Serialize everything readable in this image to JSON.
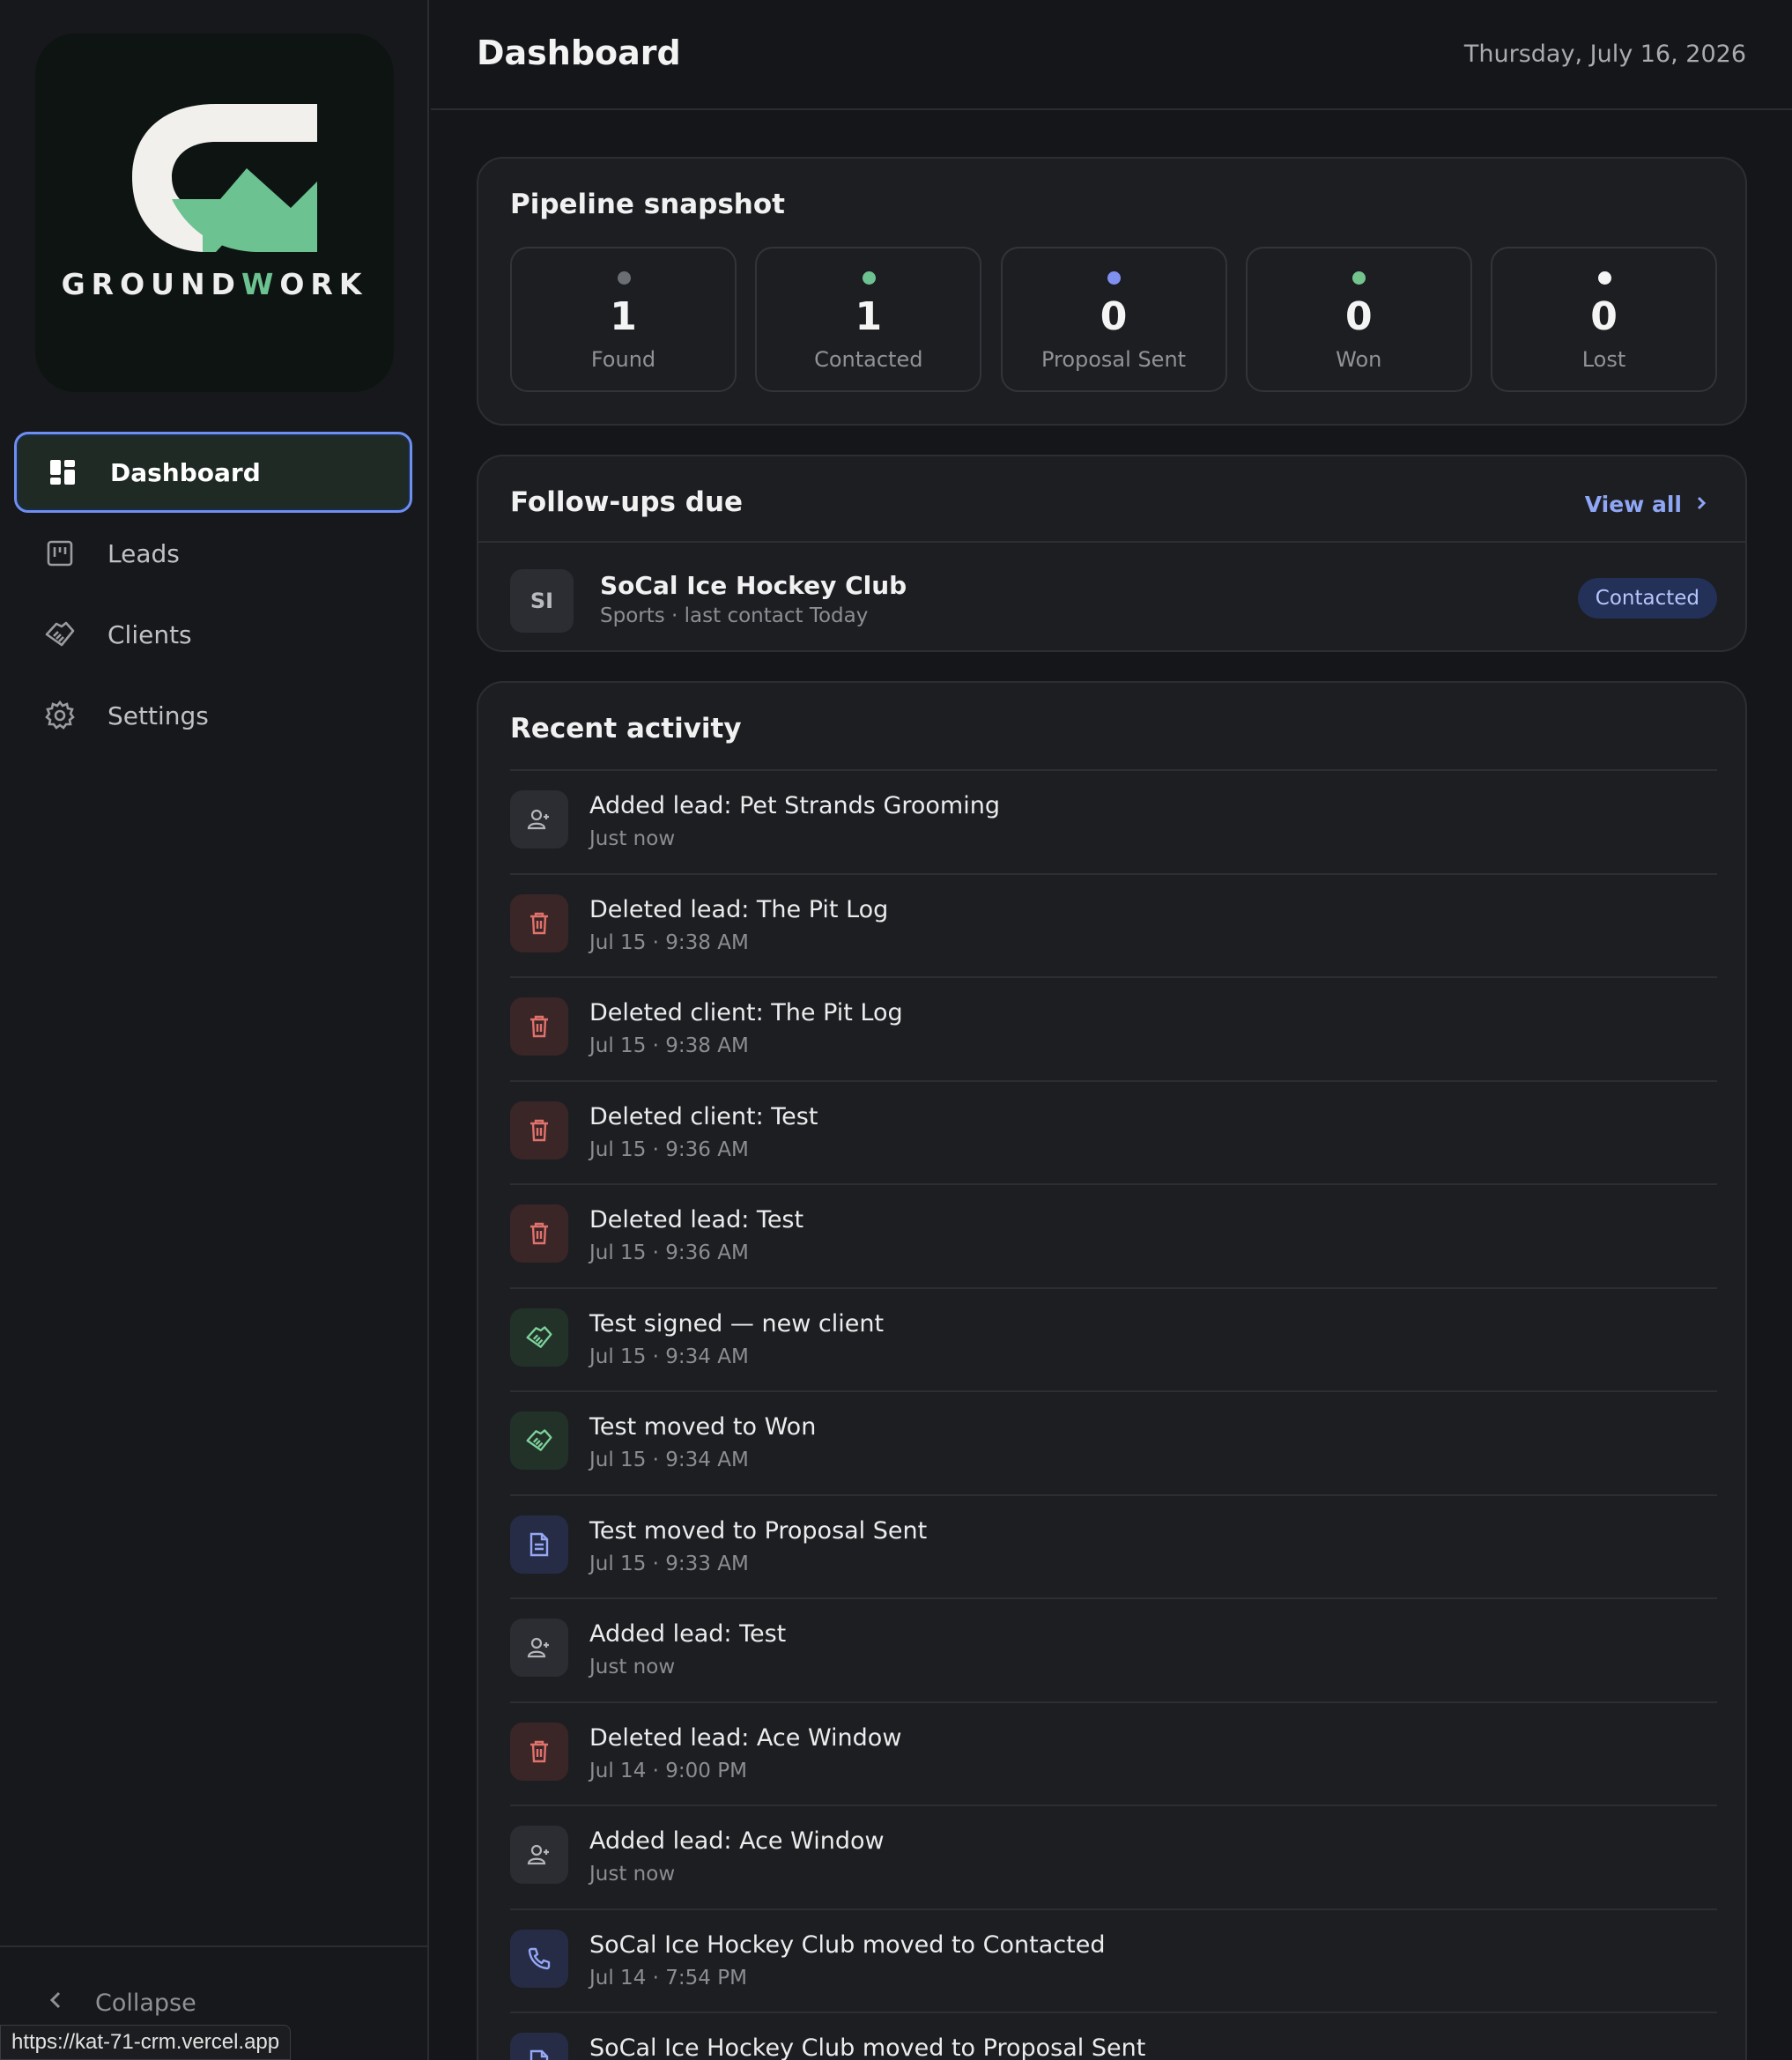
{
  "brand": {
    "name_prefix": "GROUND",
    "name_accent": "W",
    "name_suffix": "ORK",
    "accent_color": "#6cc290"
  },
  "sidebar": {
    "items": [
      {
        "label": "Dashboard",
        "icon": "dashboard-icon",
        "active": true
      },
      {
        "label": "Leads",
        "icon": "kanban-icon"
      },
      {
        "label": "Clients",
        "icon": "handshake-icon"
      },
      {
        "label": "Settings",
        "icon": "gear-icon"
      }
    ],
    "collapse_label": "Collapse"
  },
  "status_url": "https://kat-71-crm.vercel.app",
  "header": {
    "title": "Dashboard",
    "date": "Thursday, July 16, 2026"
  },
  "pipeline": {
    "title": "Pipeline snapshot",
    "stages": [
      {
        "count": "1",
        "label": "Found",
        "color": "#6b6e73"
      },
      {
        "count": "1",
        "label": "Contacted",
        "color": "#6cc290"
      },
      {
        "count": "0",
        "label": "Proposal Sent",
        "color": "#7f90f0"
      },
      {
        "count": "0",
        "label": "Won",
        "color": "#74c48e"
      },
      {
        "count": "0",
        "label": "Lost",
        "color": "#f5f5f5"
      }
    ]
  },
  "followups": {
    "title": "Follow-ups due",
    "view_all": "View all",
    "items": [
      {
        "initials": "SI",
        "name": "SoCal Ice Hockey Club",
        "meta": "Sports · last contact Today",
        "status": "Contacted"
      }
    ]
  },
  "activity": {
    "title": "Recent activity",
    "items": [
      {
        "text": "Added lead: Pet Strands Grooming",
        "time": "Just now",
        "kind": "gray",
        "icon": "add-user-icon"
      },
      {
        "text": "Deleted lead: The Pit Log",
        "time": "Jul 15 · 9:38 AM",
        "kind": "red",
        "icon": "trash-icon"
      },
      {
        "text": "Deleted client: The Pit Log",
        "time": "Jul 15 · 9:38 AM",
        "kind": "red",
        "icon": "trash-icon"
      },
      {
        "text": "Deleted client: Test",
        "time": "Jul 15 · 9:36 AM",
        "kind": "red",
        "icon": "trash-icon"
      },
      {
        "text": "Deleted lead: Test",
        "time": "Jul 15 · 9:36 AM",
        "kind": "red",
        "icon": "trash-icon"
      },
      {
        "text": "Test signed — new client",
        "time": "Jul 15 · 9:34 AM",
        "kind": "green",
        "icon": "handshake-icon"
      },
      {
        "text": "Test moved to Won",
        "time": "Jul 15 · 9:34 AM",
        "kind": "green",
        "icon": "handshake-icon"
      },
      {
        "text": "Test moved to Proposal Sent",
        "time": "Jul 15 · 9:33 AM",
        "kind": "blue",
        "icon": "document-icon"
      },
      {
        "text": "Added lead: Test",
        "time": "Just now",
        "kind": "gray",
        "icon": "add-user-icon"
      },
      {
        "text": "Deleted lead: Ace Window",
        "time": "Jul 14 · 9:00 PM",
        "kind": "red",
        "icon": "trash-icon"
      },
      {
        "text": "Added lead: Ace Window",
        "time": "Just now",
        "kind": "gray",
        "icon": "add-user-icon"
      },
      {
        "text": "SoCal Ice Hockey Club moved to Contacted",
        "time": "Jul 14 · 7:54 PM",
        "kind": "blue",
        "icon": "phone-icon"
      },
      {
        "text": "SoCal Ice Hockey Club moved to Proposal Sent",
        "time": "",
        "kind": "blue",
        "icon": "document-icon"
      }
    ]
  }
}
